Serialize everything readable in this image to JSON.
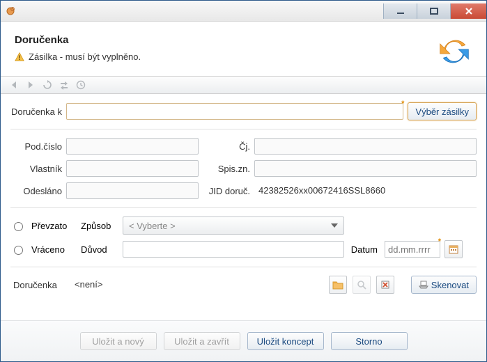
{
  "header": {
    "title": "Doručenka",
    "warning": "Zásilka - musí být vyplněno."
  },
  "section1": {
    "label_k": "Doručenka k",
    "select_btn": "Výběr zásilky"
  },
  "fields": {
    "pod_cislo_label": "Pod.číslo",
    "pod_cislo": "",
    "cj_label": "Čj.",
    "cj": "",
    "vlastnik_label": "Vlastník",
    "vlastnik": "",
    "spiszn_label": "Spis.zn.",
    "spiszn": "",
    "odeslano_label": "Odesláno",
    "odeslano": "",
    "jid_label": "JID doruč.",
    "jid": "42382526xx00672416SSL8660"
  },
  "delivery": {
    "prevzato_label": "Převzato",
    "zpusob_label": "Způsob",
    "zpusob_placeholder": "< Vyberte >",
    "vraceno_label": "Vráceno",
    "duvod_label": "Důvod",
    "duvod": "",
    "datum_label": "Datum",
    "datum_placeholder": "dd.mm.rrrr"
  },
  "attach": {
    "label": "Doručenka",
    "value": "<není>",
    "scan_btn": "Skenovat"
  },
  "footer": {
    "save_new": "Uložit a nový",
    "save_close": "Uložit a zavřít",
    "save_draft": "Uložit koncept",
    "cancel": "Storno"
  }
}
